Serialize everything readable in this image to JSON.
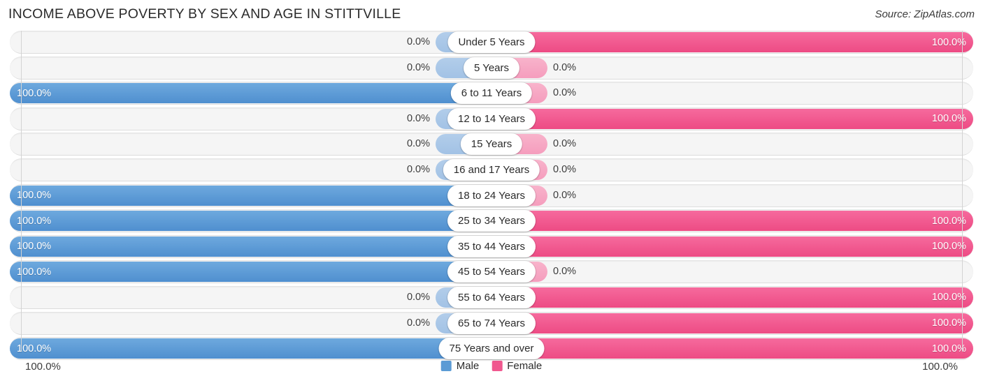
{
  "header": {
    "title": "INCOME ABOVE POVERTY BY SEX AND AGE IN STITTVILLE",
    "source": "Source: ZipAtlas.com"
  },
  "legend": {
    "items": [
      {
        "label": "Male",
        "color": "#5b9bd5",
        "icon": "legend-swatch"
      },
      {
        "label": "Female",
        "color": "#f0588f",
        "icon": "legend-swatch"
      }
    ]
  },
  "axis": {
    "left_label": "100.0%",
    "right_label": "100.0%",
    "max": 100
  },
  "colors": {
    "male": "#5b9bd5",
    "male_zero": "#a8c7e8",
    "female": "#f0588f",
    "female_zero": "#f6a8c4",
    "track": "#f5f5f5",
    "background": "#ffffff"
  },
  "chart_data": {
    "type": "bar",
    "title": "INCOME ABOVE POVERTY BY SEX AND AGE IN STITTVILLE",
    "subtitle": "",
    "orientation": "horizontal-diverging",
    "xlabel": "",
    "ylabel": "",
    "xlim": [
      0,
      100
    ],
    "grid": false,
    "legend_position": "bottom-center",
    "categories": [
      "Under 5 Years",
      "5 Years",
      "6 to 11 Years",
      "12 to 14 Years",
      "15 Years",
      "16 and 17 Years",
      "18 to 24 Years",
      "25 to 34 Years",
      "35 to 44 Years",
      "45 to 54 Years",
      "55 to 64 Years",
      "65 to 74 Years",
      "75 Years and over"
    ],
    "series": [
      {
        "name": "Male",
        "values": [
          0.0,
          0.0,
          100.0,
          0.0,
          0.0,
          0.0,
          100.0,
          100.0,
          100.0,
          100.0,
          0.0,
          0.0,
          100.0
        ],
        "labels": [
          "0.0%",
          "0.0%",
          "100.0%",
          "0.0%",
          "0.0%",
          "0.0%",
          "100.0%",
          "100.0%",
          "100.0%",
          "100.0%",
          "0.0%",
          "0.0%",
          "100.0%"
        ]
      },
      {
        "name": "Female",
        "values": [
          100.0,
          0.0,
          0.0,
          100.0,
          0.0,
          0.0,
          0.0,
          100.0,
          100.0,
          0.0,
          100.0,
          100.0,
          100.0
        ],
        "labels": [
          "100.0%",
          "0.0%",
          "0.0%",
          "100.0%",
          "0.0%",
          "0.0%",
          "0.0%",
          "100.0%",
          "100.0%",
          "0.0%",
          "100.0%",
          "100.0%",
          "100.0%"
        ]
      }
    ]
  }
}
